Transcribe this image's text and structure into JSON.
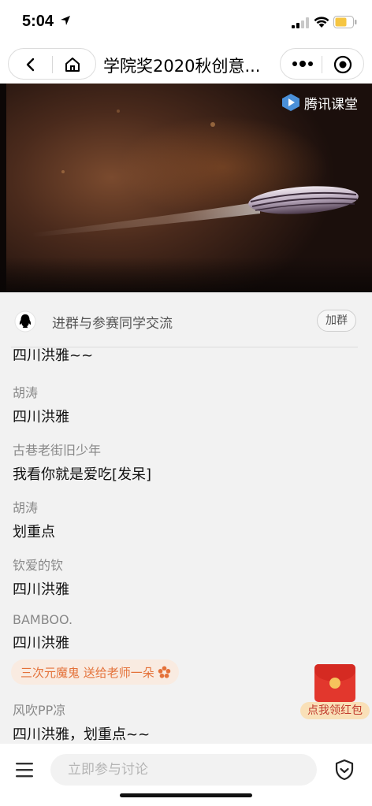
{
  "status_bar": {
    "time": "5:04",
    "icons": [
      "location-arrow-icon",
      "signal-icon",
      "wifi-icon",
      "battery-icon"
    ],
    "battery_color": "#f5c542"
  },
  "nav": {
    "title": "学院奖2020秋创意...",
    "icons": [
      "back-icon",
      "home-icon",
      "more-icon",
      "close-target-icon"
    ]
  },
  "video": {
    "logo_text": "腾讯课堂",
    "logo_icon": "tencent-classroom-play-icon"
  },
  "group": {
    "icon": "qq-penguin-icon",
    "text": "进群与参赛同学交流",
    "join_label": "加群"
  },
  "messages": [
    {
      "name": "",
      "text": "四川洪雅~~"
    },
    {
      "name": "胡涛",
      "text": "四川洪雅"
    },
    {
      "name": "古巷老街旧少年",
      "text": "我看你就是爱吃[发呆]"
    },
    {
      "name": "胡涛",
      "text": "划重点"
    },
    {
      "name": "钦爱的钦",
      "text": "四川洪雅"
    },
    {
      "name": "BAMBOO.",
      "text": "四川洪雅"
    },
    {
      "name": "风吹PP凉",
      "text": "四川洪雅，划重点~~"
    }
  ],
  "gift": {
    "text": "三次元魔鬼 送给老师一朵",
    "icon": "flower-icon",
    "color": "#e4723a"
  },
  "red_packet": {
    "label": "点我领红包",
    "color": "#e2372d"
  },
  "bottom": {
    "placeholder": "立即参与讨论",
    "icons": [
      "menu-icon",
      "shield-icon"
    ]
  }
}
